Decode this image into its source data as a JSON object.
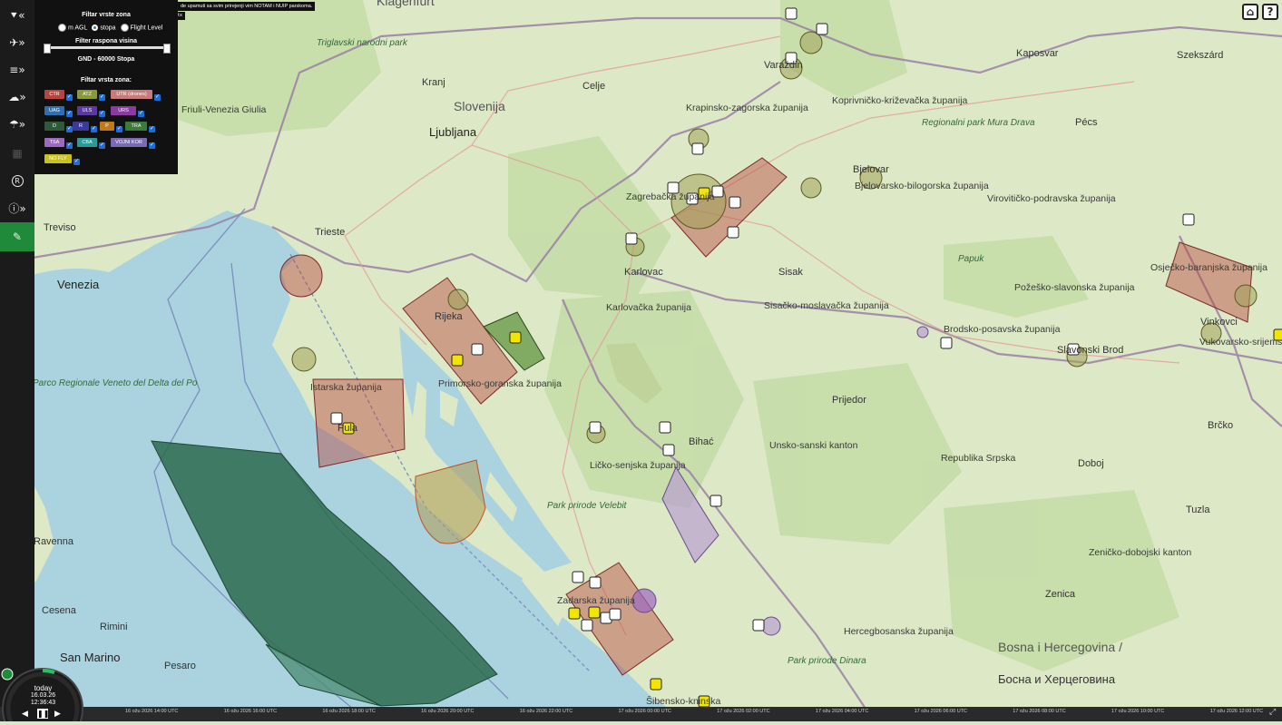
{
  "notice": {
    "text": "de upamuti sa svim prirejenji vim NOTAM i NUIP parskoma.",
    "tail": "tx"
  },
  "filter_panel": {
    "zone_type_title": "Filtar vrste zona",
    "radio_options": [
      "m AGL",
      "stopa",
      "Flight Level"
    ],
    "radio_selected": "stopa",
    "altitude_title": "Filter raspona visina",
    "altitude_range": "GND - 60000 Stopa",
    "zone_filter_title": "Filtar vrsta zona:",
    "zone_types": [
      {
        "label": "CTR",
        "color": "#b8443f",
        "checked": true
      },
      {
        "label": "ATZ",
        "color": "#8a9a3a",
        "checked": true
      },
      {
        "label": "UTR (drones)",
        "color": "#c97a7a",
        "checked": true
      },
      {
        "label": "UAG",
        "color": "#2f6fb0",
        "checked": true
      },
      {
        "label": "ULS",
        "color": "#5a3aa0",
        "checked": true
      },
      {
        "label": "URS",
        "color": "#8a3aa0",
        "checked": true
      },
      {
        "label": "D",
        "color": "#2d5a3a",
        "checked": true
      },
      {
        "label": "R",
        "color": "#3a3a9a",
        "checked": true
      },
      {
        "label": "P",
        "color": "#c07a1a",
        "checked": true
      },
      {
        "label": "TRA",
        "color": "#3a7a3a",
        "checked": true
      },
      {
        "label": "TSA",
        "color": "#9a6ac0",
        "checked": true
      },
      {
        "label": "CBA",
        "color": "#2a9a9a",
        "checked": true
      },
      {
        "label": "VOJNI KOR",
        "color": "#7a6ab0",
        "checked": true
      },
      {
        "label": "NO FLY",
        "color": "#c9c21a",
        "checked": true
      }
    ]
  },
  "toolbar": {
    "buttons": [
      {
        "icon": "filter-icon",
        "glyph": "⯆«"
      },
      {
        "icon": "aircraft-icon",
        "glyph": "✈»"
      },
      {
        "icon": "layers-icon",
        "glyph": "≡»"
      },
      {
        "icon": "cloud-icon",
        "glyph": "☁»"
      },
      {
        "icon": "weather-icon",
        "glyph": "☂»"
      },
      {
        "icon": "calendar-icon",
        "glyph": "▦"
      },
      {
        "icon": "registered-icon",
        "glyph": "R"
      },
      {
        "icon": "info-icon",
        "glyph": "ⓘ»"
      },
      {
        "icon": "drone-icon",
        "glyph": "✎"
      }
    ]
  },
  "top_right": {
    "home_icon": "home-icon",
    "help_icon": "help-icon",
    "help_glyph": "?",
    "home_glyph": "⌂"
  },
  "clock": {
    "day": "today",
    "date": "16.03.26",
    "time": "12:36:43"
  },
  "timeline": {
    "labels": [
      "16 ožu 2026 14:00 UTC",
      "16 ožu 2026 16:00 UTC",
      "16 ožu 2026 18:00 UTC",
      "16 ožu 2026 20:00 UTC",
      "16 ožu 2026 22:00 UTC",
      "17 ožu 2026 00:00 UTC",
      "17 ožu 2026 02:00 UTC",
      "17 ožu 2026 04:00 UTC",
      "17 ožu 2026 06:00 UTC",
      "17 ožu 2026 08:00 UTC",
      "17 ožu 2026 10:00 UTC",
      "17 ožu 2026 12:00 UTC"
    ]
  },
  "places": {
    "klagenfurt": "Klagenfurt",
    "kaposvar": "Kaposvar",
    "szekszard": "Szekszárd",
    "triglav": "Triglavski narodni park",
    "slovenija": "Slovenija",
    "kranj": "Kranj",
    "celje": "Celje",
    "ljubljana": "Ljubljana",
    "varazdin": "Varaždin",
    "krapinsko": "Krapinsko-zagorska županija",
    "koprivnicko": "Koprivničko-križevačka županija",
    "regionalni_park": "Regionalni park Mura Drava",
    "pecs": "Pécs",
    "furlanija": "Friuli-Venezia Giulia",
    "treviso": "Treviso",
    "trieste": "Trieste",
    "venezia": "Venezia",
    "zagrebacka": "Zagrebačka županija",
    "bjelovar": "Bjelovar",
    "bjelovarsko": "Bjelovarsko-bilogorska županija",
    "viroviticko": "Virovitičko-podravska županija",
    "karlovac": "Karlovac",
    "sisak": "Sisak",
    "karlovacka": "Karlovačka županija",
    "sisacko": "Sisačko-moslavačka županija",
    "osjecko": "Osječko-baranjska županija",
    "pozesko": "Požeško-slavonska županija",
    "papuk": "Papuk",
    "rijeka": "Rijeka",
    "brodsko": "Brodsko-posavska županija",
    "slavonski": "Slavonski Brod",
    "vinkovci": "Vinkovci",
    "vukovarsko": "Vukovarsko-srijemska županija",
    "parco_delta": "Parco Regionale Veneto del Delta del Po",
    "istarska": "Istarska županija",
    "pula": "Pula",
    "primorsko": "Primorsko-goranska županija",
    "prijedor": "Prijedor",
    "bihac": "Bihać",
    "licko": "Ličko-senjska županija",
    "unsko": "Unsko-sanski kanton",
    "republika": "Republika Srpska",
    "doboj": "Doboj",
    "brcko": "Brčko",
    "tuzla": "Tuzla",
    "ravenna": "Ravenna",
    "velebit": "Park prirode Velebit",
    "cesena": "Cesena",
    "rimini": "Rimini",
    "san_marino": "San Marino",
    "pesaro": "Pesaro",
    "zadarska": "Zadarska županija",
    "zenicko": "Zeničko-dobojski kanton",
    "zenica": "Zenica",
    "hercegbosanska": "Hercegbosanska županija",
    "dinara": "Park prirode Dinara",
    "sibensko": "Šibensko-kninska",
    "bosna": "Bosna i Hercegovina /",
    "bosna_cyr": "Босна и Херцеговина"
  },
  "colors": {
    "sea": "#aad3df",
    "land": "#e4eecf",
    "ctr": "#b8443f",
    "tra": "#2d6a4f",
    "atz": "#8a9a3a",
    "tsa": "#9a6ac0",
    "noFly": "#f2e600",
    "border": "#9b7fa6"
  }
}
